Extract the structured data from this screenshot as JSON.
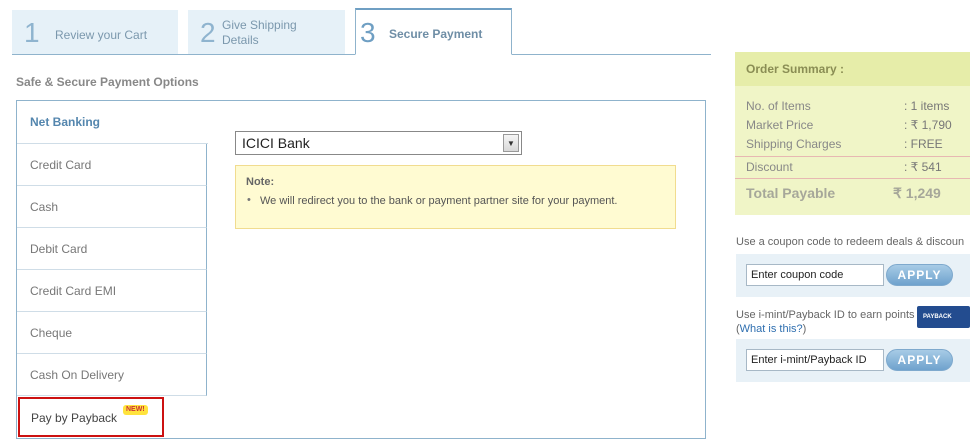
{
  "steps": [
    {
      "number": "1",
      "label": "Review your Cart"
    },
    {
      "number": "2",
      "label": "Give Shipping Details"
    },
    {
      "number": "3",
      "label": "Secure Payment"
    }
  ],
  "section_title": "Safe & Secure Payment Options",
  "payment_options": [
    "Net Banking",
    "Credit Card",
    "Cash",
    "Debit Card",
    "Credit Card EMI",
    "Cheque",
    "Cash On Delivery",
    "Pay by Payback"
  ],
  "new_badge": "NEW!",
  "bank_select": {
    "selected": "ICICI Bank"
  },
  "note": {
    "title": "Note:",
    "text": "We will redirect you to the bank or payment partner site for your payment."
  },
  "order_summary": {
    "title": "Order Summary :",
    "rows": [
      {
        "label": "No. of Items",
        "value": ": 1 items"
      },
      {
        "label": "Market Price",
        "value": ": ₹ 1,790"
      },
      {
        "label": "Shipping Charges",
        "value": ": FREE"
      },
      {
        "label": "Discount",
        "value": ": ₹ 541"
      }
    ],
    "total_label": "Total Payable",
    "total_value": "₹ 1,249"
  },
  "coupon": {
    "text": "Use a coupon code to redeem deals & discoun",
    "placeholder": "Enter coupon code",
    "apply": "APPLY"
  },
  "payback": {
    "text": "Use i-mint/Payback ID to earn points",
    "link_text": "What is this?",
    "placeholder": "Enter i-mint/Payback ID",
    "apply": "APPLY",
    "logo_text": "PAYBACK"
  },
  "colors": {
    "accent_blue": "#6f9fc3",
    "summary_bg": "#f0f5c7",
    "note_bg": "#fffbd2",
    "highlight_red": "#cc1111"
  }
}
